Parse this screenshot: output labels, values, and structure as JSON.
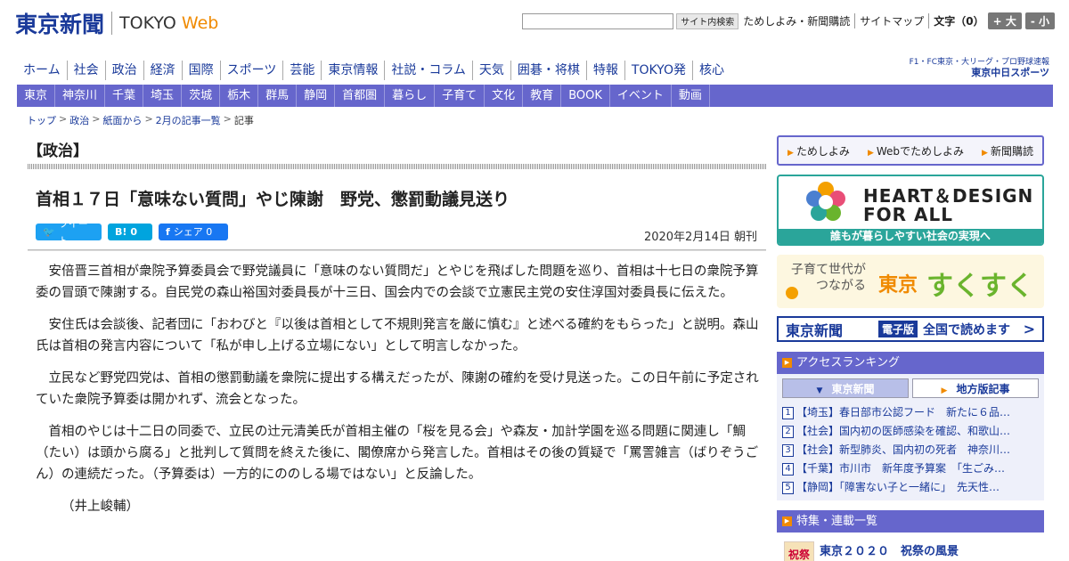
{
  "header": {
    "logo_jp": "東京新聞",
    "logo_en": "TOKYO",
    "logo_web": "Web",
    "search_button": "サイト内検索",
    "links": [
      "ためしよみ・新聞購読",
      "サイトマップ"
    ],
    "font_label": "文字（0）",
    "font_plus": "+ 大",
    "font_minus": "- 小"
  },
  "global_nav": [
    "ホーム",
    "社会",
    "政治",
    "経済",
    "国際",
    "スポーツ",
    "芸能",
    "東京情報",
    "社説・コラム",
    "天気",
    "囲碁・将棋",
    "特報",
    "TOKYO発",
    "核心"
  ],
  "sports_banner": {
    "line1": "F1・FC東京・大リーグ・プロ野球速報",
    "line2": "東京中日スポーツ"
  },
  "region_nav": [
    "東京",
    "神奈川",
    "千葉",
    "埼玉",
    "茨城",
    "栃木",
    "群馬",
    "静岡",
    "首都圏",
    "暮らし",
    "子育て",
    "文化",
    "教育",
    "BOOK",
    "イベント",
    "動画"
  ],
  "breadcrumb": [
    "トップ",
    "政治",
    "紙面から",
    "2月の記事一覧",
    "記事"
  ],
  "article": {
    "section": "【政治】",
    "headline": "首相１７日「意味ない質問」やじ陳謝　野党、懲罰動議見送り",
    "share": {
      "tweet": "ツイート",
      "hatena": "B!",
      "hatena_count": "0",
      "facebook": "シェア",
      "facebook_count": "0"
    },
    "date": "2020年2月14日 朝刊",
    "paragraphs": [
      "安倍晋三首相が衆院予算委員会で野党議員に「意味のない質問だ」とやじを飛ばした問題を巡り、首相は十七日の衆院予算委の冒頭で陳謝する。自民党の森山裕国対委員長が十三日、国会内での会談で立憲民主党の安住淳国対委員長に伝えた。",
      "安住氏は会談後、記者団に「おわびと『以後は首相として不規則発言を厳に慎む』と述べる確約をもらった」と説明。森山氏は首相の発言内容について「私が申し上げる立場にない」として明言しなかった。",
      "立民など野党四党は、首相の懲罰動議を衆院に提出する構えだったが、陳謝の確約を受け見送った。この日午前に予定されていた衆院予算委は開かれず、流会となった。",
      "首相のやじは十二日の同委で、立民の辻元清美氏が首相主催の「桜を見る会」や森友・加計学園を巡る問題に関連し「鯛（たい）は頭から腐る」と批判して質問を終えた後に、閣僚席から発言した。首相はその後の質疑で「罵詈雑言（ばりぞうごん）の連続だった。（予算委は）一方的にののしる場ではない」と反論した。"
    ],
    "byline": "（井上峻輔）"
  },
  "sidebar": {
    "try_links": [
      "ためしよみ",
      "Webでためしよみ",
      "新聞購読"
    ],
    "heart_design": {
      "line1": "HEART＆DESIGN",
      "line2": "FOR ALL",
      "band": "誰もが暮らしやすい社会の実現へ"
    },
    "sukusuku": {
      "line1": "子育て世代が",
      "line2": "つながる",
      "tokyo": "東京",
      "name": "すくすく"
    },
    "epaper": {
      "brand": "東京新聞",
      "tag": "電子版",
      "text": "全国で読めます",
      "arrow": ">"
    },
    "ranking": {
      "title": "アクセスランキング",
      "tabs": [
        "東京新聞",
        "地方版記事"
      ],
      "items": [
        "【埼玉】春日部市公認フード　新たに６品…",
        "【社会】国内初の医師感染を確認、和歌山…",
        "【社会】新型肺炎、国内初の死者　神奈川…",
        "【千葉】市川市　新年度予算案　「生ごみ…",
        "【静岡】「障害ない子と一緒に」　先天性…"
      ]
    },
    "features": {
      "title": "特集・連載一覧",
      "thumb": "祝祭",
      "first": "東京２０２０　祝祭の風景"
    }
  },
  "colors": {
    "brand_blue": "#1a3a9a",
    "nav_purple": "#6666cc",
    "accent_orange": "#f08a00",
    "heart_green": "#2aa59a"
  }
}
